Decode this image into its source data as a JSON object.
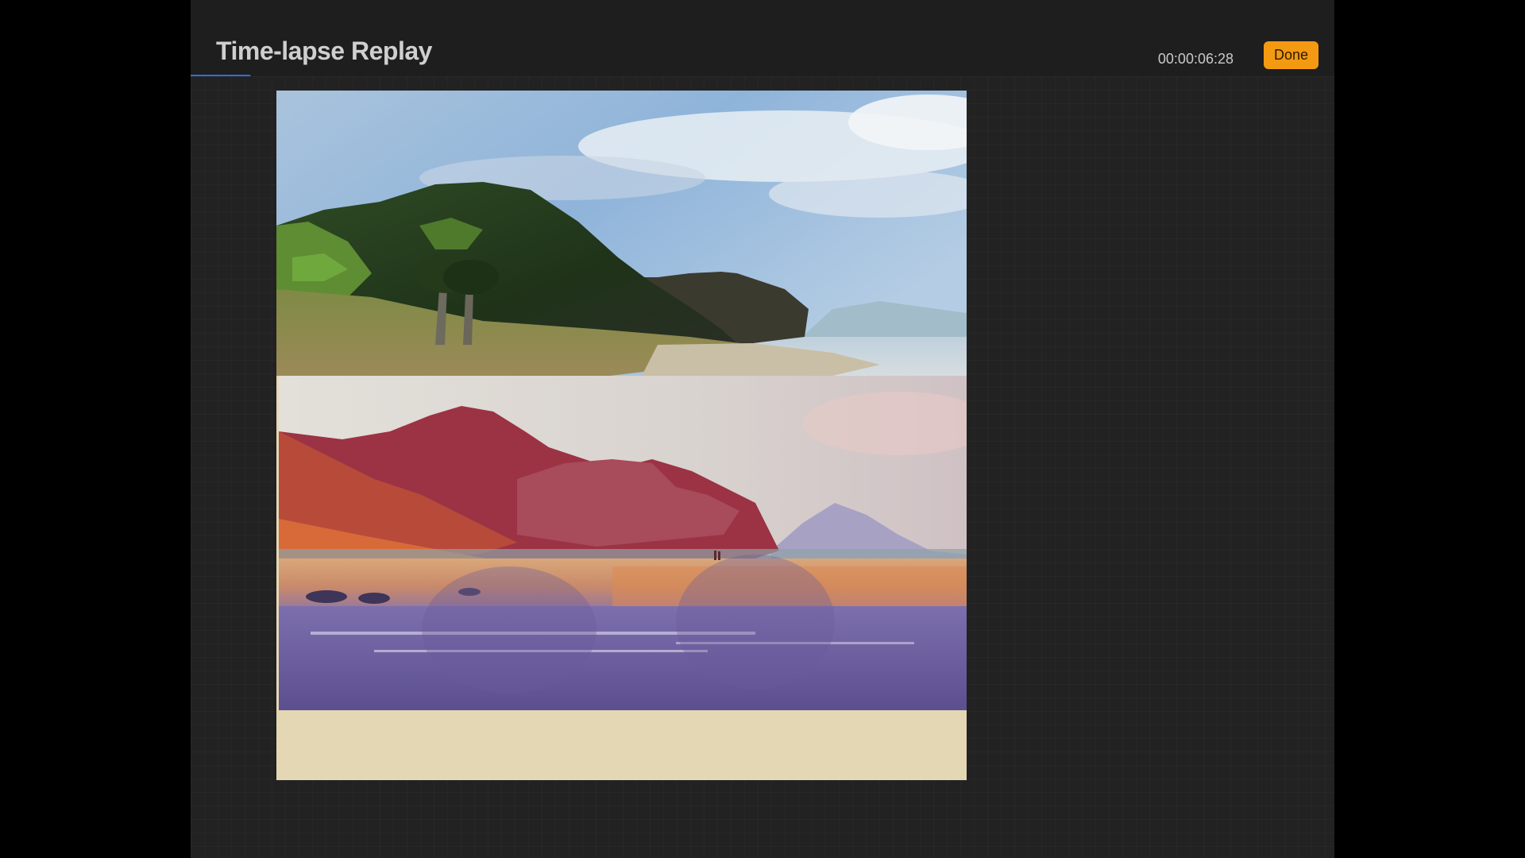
{
  "header": {
    "title": "Time-lapse Replay",
    "timestamp": "00:00:06:28",
    "done_label": "Done",
    "replay_progress": 0.053
  },
  "canvas": {
    "photo_icon": "landscape-photo-reference",
    "painting_icon": "landscape-painting"
  },
  "colors": {
    "accent_done": "#f39a12",
    "progress": "#2f6de1",
    "background": "#1f1f1f",
    "canvas_cream": "#e4d7b4",
    "status_dot": "#e8891a"
  }
}
